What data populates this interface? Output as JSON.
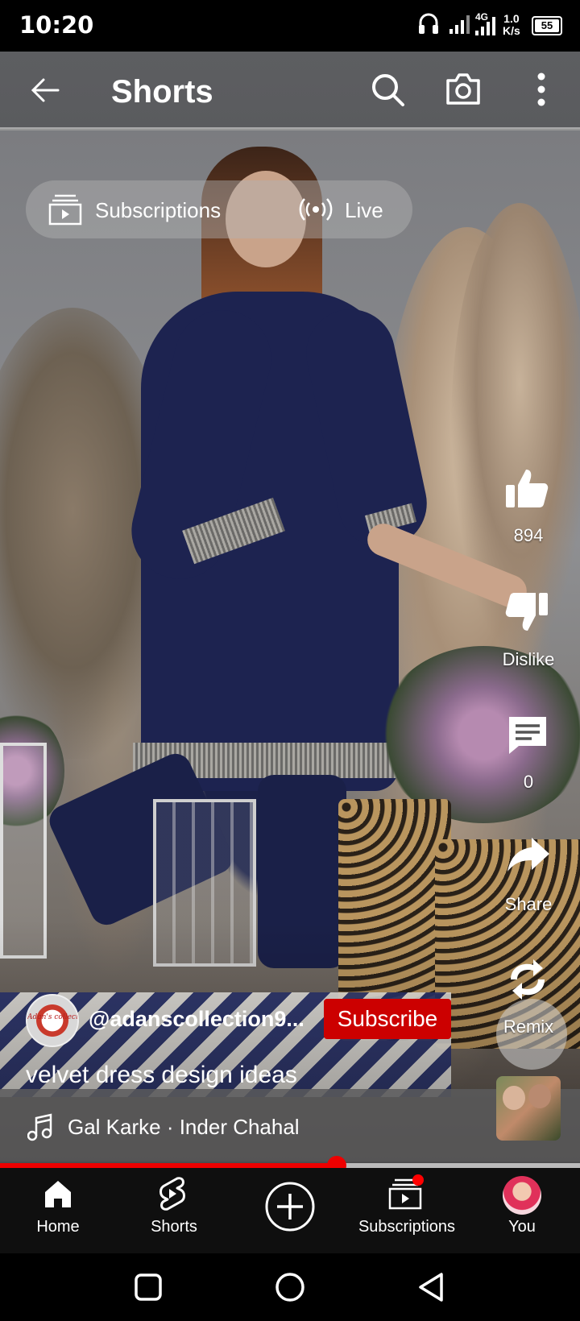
{
  "status_bar": {
    "time": "10:20",
    "network": "4G",
    "speed_value": "1.0",
    "speed_unit": "K/s",
    "battery": "55"
  },
  "header": {
    "title": "Shorts",
    "back_icon": "arrow-left-icon",
    "search_icon": "search-icon",
    "camera_icon": "camera-icon",
    "more_icon": "more-vert-icon"
  },
  "feed_switch": {
    "subscriptions_label": "Subscriptions",
    "live_label": "Live"
  },
  "actions": {
    "like_count": "894",
    "dislike_label": "Dislike",
    "comments_count": "0",
    "share_label": "Share",
    "remix_label": "Remix"
  },
  "video": {
    "channel": "@adanscollection9...",
    "channel_logo_text": "Adan's collection",
    "subscribe_label": "Subscribe",
    "caption": "velvet dress design ideas",
    "music": "Gal Karke · Inder Chahal",
    "progress": 0.58
  },
  "bottom_nav": [
    {
      "label": "Home",
      "icon": "home-icon"
    },
    {
      "label": "Shorts",
      "icon": "shorts-icon"
    },
    {
      "label": "",
      "icon": "create-plus-icon"
    },
    {
      "label": "Subscriptions",
      "icon": "subscriptions-icon"
    },
    {
      "label": "You",
      "icon": "profile-avatar"
    }
  ],
  "colors": {
    "accent": "#ff0000",
    "subscribe_bg": "#cc0000",
    "nav_bg": "#0f0f0f"
  }
}
